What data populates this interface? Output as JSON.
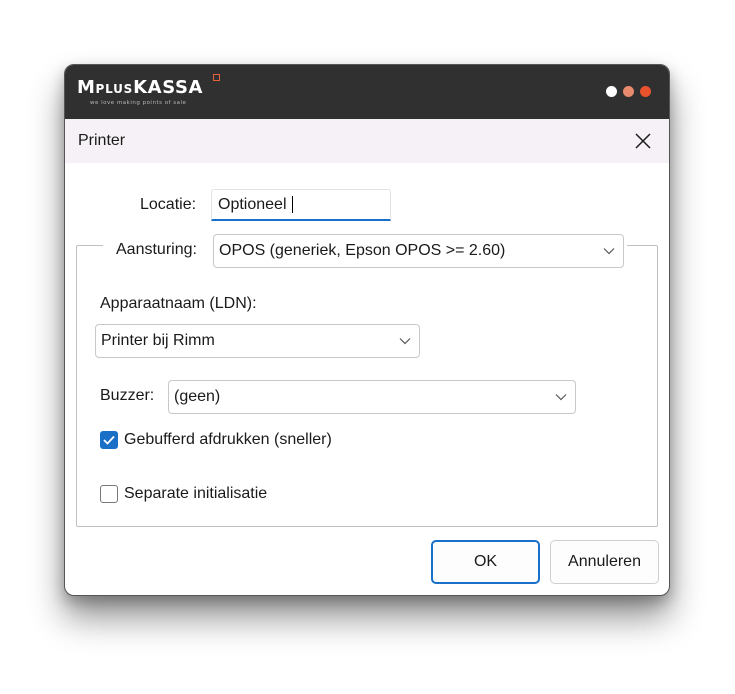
{
  "app": {
    "brand_main": "MPLUS",
    "brand_accent": "KASSA",
    "tagline": "we love making points of sale",
    "colors": {
      "titlebar": "#303030",
      "dot1": "#ffffff",
      "dot2": "#e88a6e",
      "dot3": "#e8522d",
      "accent": "#1a6fc7"
    }
  },
  "dialog": {
    "title": "Printer",
    "close_icon": "close-icon"
  },
  "form": {
    "locatie_label": "Locatie:",
    "locatie_value": "Optioneel",
    "aansturing_label": "Aansturing:",
    "aansturing_value": "OPOS (generiek, Epson OPOS >= 2.60)",
    "ldn_label": "Apparaatnaam (LDN):",
    "ldn_value": "Printer bij Rimm",
    "buzzer_label": "Buzzer:",
    "buzzer_value": "(geen)",
    "buffered_label": "Gebufferd afdrukken (sneller)",
    "buffered_checked": true,
    "separate_label": "Separate initialisatie",
    "separate_checked": false
  },
  "buttons": {
    "ok": "OK",
    "cancel": "Annuleren"
  }
}
